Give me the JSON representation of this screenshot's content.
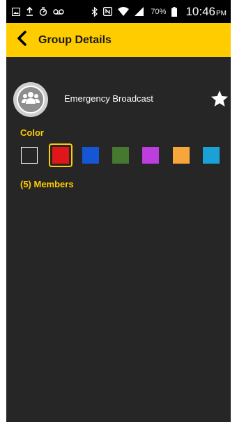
{
  "status_bar": {
    "battery_text": "70%",
    "time": "10:46",
    "ampm": "PM",
    "icons": [
      "image-icon",
      "upload-icon",
      "timer-icon",
      "voicemail-icon",
      "bluetooth-icon",
      "nfc-icon",
      "wifi-icon",
      "signal-icon",
      "battery-icon"
    ]
  },
  "header": {
    "title": "Group Details",
    "background": "#ffcc00",
    "back_icon": "chevron-left-icon"
  },
  "group": {
    "name": "Emergency Broadcast",
    "avatar_icon": "group-people-icon",
    "favorite_icon": "star-icon",
    "favorited": true
  },
  "color_section": {
    "label": "Color",
    "selected_color": "red",
    "swatches": [
      {
        "name": "white",
        "color": "#ffffff"
      },
      {
        "name": "red",
        "color": "#e0161b"
      },
      {
        "name": "blue",
        "color": "#1556d4"
      },
      {
        "name": "green",
        "color": "#46782f"
      },
      {
        "name": "purple",
        "color": "#be3ddf"
      },
      {
        "name": "orange",
        "color": "#f6a63a"
      },
      {
        "name": "cyan",
        "color": "#1aa1d6"
      }
    ]
  },
  "members": {
    "label": "(5) Members"
  },
  "colors": {
    "accent": "#ffcc00",
    "background": "#262626",
    "status_bar": "#000000"
  }
}
